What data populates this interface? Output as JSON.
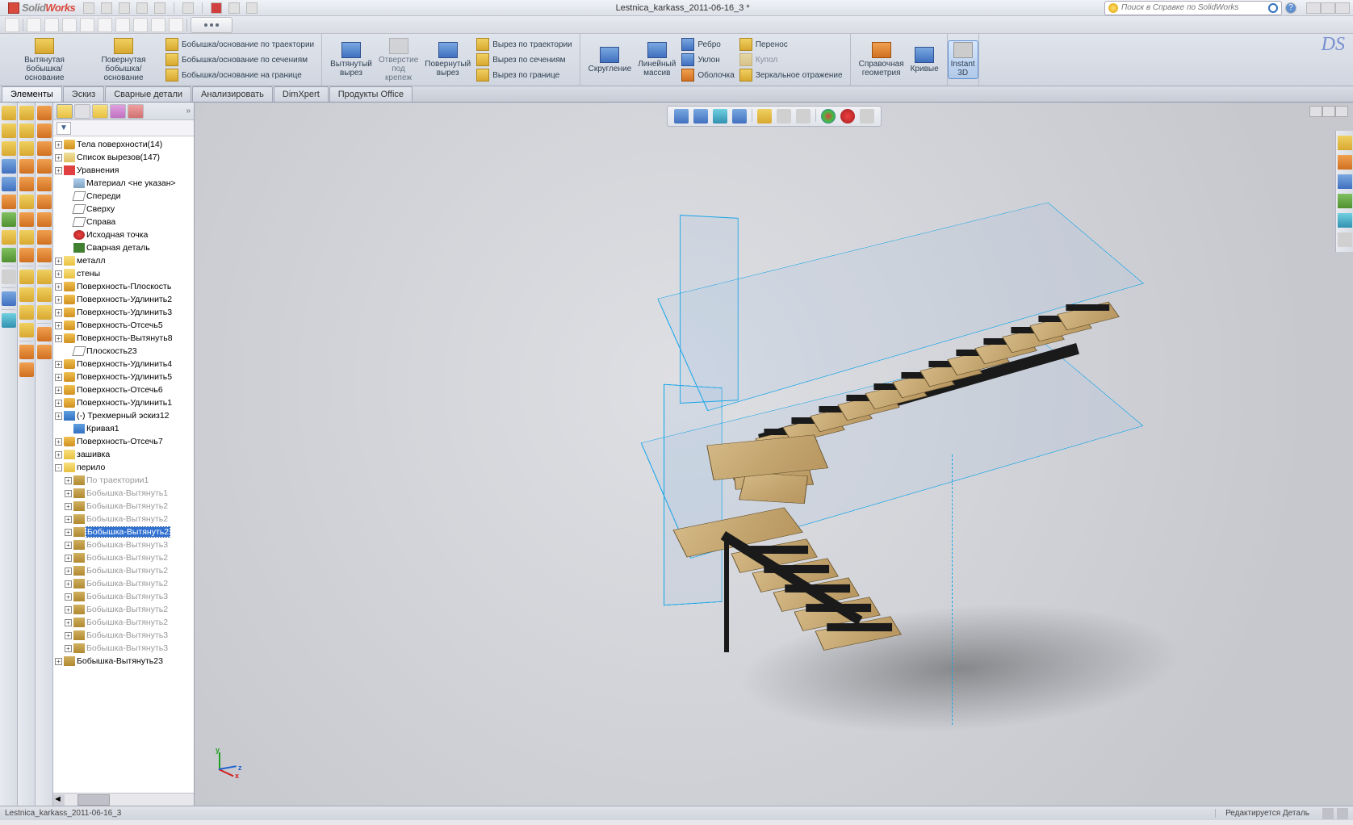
{
  "titlebar": {
    "brand_a": "Solid",
    "brand_b": "Works",
    "doc_title": "Lestnica_karkass_2011-06-16_3 *",
    "search_placeholder": "Поиск в Справке по SolidWorks"
  },
  "ribbon": {
    "g1": {
      "extrude_boss": "Вытянутая\nбобышка/основание",
      "revolve_boss": "Повернутая\nбобышка/основание"
    },
    "g1b": {
      "sweep": "Бобышка/основание по траектории",
      "loft": "Бобышка/основание по сечениям",
      "boundary": "Бобышка/основание на границе"
    },
    "g2": {
      "extrude_cut": "Вытянутый\nвырез",
      "hole": "Отверстие\nпод\nкрепеж",
      "revolve_cut": "Повернутый\nвырез"
    },
    "g2b": {
      "sweep_cut": "Вырез по траектории",
      "loft_cut": "Вырез по сечениям",
      "boundary_cut": "Вырез по границе"
    },
    "g3": {
      "fillet": "Скругление",
      "pattern": "Линейный\nмассив"
    },
    "g3b": {
      "rib": "Ребро",
      "draft": "Уклон",
      "shell": "Оболочка",
      "wrap": "Перенос",
      "dome": "Купол",
      "mirror": "Зеркальное отражение"
    },
    "g4": {
      "refgeom": "Справочная\nгеометрия",
      "curves": "Кривые",
      "instant3d": "Instant\n3D"
    }
  },
  "tabs": [
    "Элементы",
    "Эскиз",
    "Сварные детали",
    "Анализировать",
    "DimXpert",
    "Продукты Office"
  ],
  "tree_filter": "▼",
  "tree": [
    {
      "exp": "+",
      "ind": 0,
      "ic": "surf",
      "lbl": "Тела поверхности(14)"
    },
    {
      "exp": "+",
      "ind": 0,
      "ic": "list",
      "lbl": "Список вырезов(147)"
    },
    {
      "exp": "+",
      "ind": 0,
      "ic": "eq",
      "lbl": "Уравнения"
    },
    {
      "exp": "",
      "ind": 1,
      "ic": "mat",
      "lbl": "Материал <не указан>"
    },
    {
      "exp": "",
      "ind": 1,
      "ic": "plane",
      "lbl": "Спереди"
    },
    {
      "exp": "",
      "ind": 1,
      "ic": "plane",
      "lbl": "Сверху"
    },
    {
      "exp": "",
      "ind": 1,
      "ic": "plane",
      "lbl": "Справа"
    },
    {
      "exp": "",
      "ind": 1,
      "ic": "origin",
      "lbl": "Исходная точка"
    },
    {
      "exp": "",
      "ind": 1,
      "ic": "weld",
      "lbl": "Сварная деталь"
    },
    {
      "exp": "+",
      "ind": 0,
      "ic": "folder",
      "lbl": "металл"
    },
    {
      "exp": "+",
      "ind": 0,
      "ic": "folder",
      "lbl": "стены"
    },
    {
      "exp": "+",
      "ind": 0,
      "ic": "surf",
      "lbl": "Поверхность-Плоскость"
    },
    {
      "exp": "+",
      "ind": 0,
      "ic": "surf",
      "lbl": "Поверхность-Удлинить2"
    },
    {
      "exp": "+",
      "ind": 0,
      "ic": "surf",
      "lbl": "Поверхность-Удлинить3"
    },
    {
      "exp": "+",
      "ind": 0,
      "ic": "surf",
      "lbl": "Поверхность-Отсечь5"
    },
    {
      "exp": "+",
      "ind": 0,
      "ic": "surf",
      "lbl": "Поверхность-Вытянуть8"
    },
    {
      "exp": "",
      "ind": 1,
      "ic": "plane",
      "lbl": "Плоскость23"
    },
    {
      "exp": "+",
      "ind": 0,
      "ic": "surf",
      "lbl": "Поверхность-Удлинить4"
    },
    {
      "exp": "+",
      "ind": 0,
      "ic": "surf",
      "lbl": "Поверхность-Удлинить5"
    },
    {
      "exp": "+",
      "ind": 0,
      "ic": "surf",
      "lbl": "Поверхность-Отсечь6"
    },
    {
      "exp": "+",
      "ind": 0,
      "ic": "surf",
      "lbl": "Поверхность-Удлинить1"
    },
    {
      "exp": "+",
      "ind": 0,
      "ic": "sketch",
      "lbl": "(-) Трехмерный эскиз12"
    },
    {
      "exp": "",
      "ind": 1,
      "ic": "sketch",
      "lbl": "Кривая1"
    },
    {
      "exp": "+",
      "ind": 0,
      "ic": "surf",
      "lbl": "Поверхность-Отсечь7"
    },
    {
      "exp": "+",
      "ind": 0,
      "ic": "folder",
      "lbl": "зашивка"
    },
    {
      "exp": "-",
      "ind": 0,
      "ic": "folder",
      "lbl": "перило"
    },
    {
      "exp": "+",
      "ind": 1,
      "ic": "feat",
      "lbl": "По траектории1",
      "gray": true
    },
    {
      "exp": "+",
      "ind": 1,
      "ic": "feat",
      "lbl": "Бобышка-Вытянуть1",
      "gray": true
    },
    {
      "exp": "+",
      "ind": 1,
      "ic": "feat",
      "lbl": "Бобышка-Вытянуть2",
      "gray": true
    },
    {
      "exp": "+",
      "ind": 1,
      "ic": "feat",
      "lbl": "Бобышка-Вытянуть2",
      "gray": true
    },
    {
      "exp": "+",
      "ind": 1,
      "ic": "feat",
      "lbl": "Бобышка-Вытянуть2",
      "sel": true
    },
    {
      "exp": "+",
      "ind": 1,
      "ic": "feat",
      "lbl": "Бобышка-Вытянуть3",
      "gray": true
    },
    {
      "exp": "+",
      "ind": 1,
      "ic": "feat",
      "lbl": "Бобышка-Вытянуть2",
      "gray": true
    },
    {
      "exp": "+",
      "ind": 1,
      "ic": "feat",
      "lbl": "Бобышка-Вытянуть2",
      "gray": true
    },
    {
      "exp": "+",
      "ind": 1,
      "ic": "feat",
      "lbl": "Бобышка-Вытянуть2",
      "gray": true
    },
    {
      "exp": "+",
      "ind": 1,
      "ic": "feat",
      "lbl": "Бобышка-Вытянуть3",
      "gray": true
    },
    {
      "exp": "+",
      "ind": 1,
      "ic": "feat",
      "lbl": "Бобышка-Вытянуть2",
      "gray": true
    },
    {
      "exp": "+",
      "ind": 1,
      "ic": "feat",
      "lbl": "Бобышка-Вытянуть2",
      "gray": true
    },
    {
      "exp": "+",
      "ind": 1,
      "ic": "feat",
      "lbl": "Бобышка-Вытянуть3",
      "gray": true
    },
    {
      "exp": "+",
      "ind": 1,
      "ic": "feat",
      "lbl": "Бобышка-Вытянуть3",
      "gray": true
    },
    {
      "exp": "+",
      "ind": 0,
      "ic": "feat",
      "lbl": "Бобышка-Вытянуть23"
    }
  ],
  "statusbar": {
    "doc": "Lestnica_karkass_2011-06-16_3",
    "status": "Редактируется Деталь"
  },
  "triad": {
    "x": "x",
    "y": "y",
    "z": "z"
  }
}
